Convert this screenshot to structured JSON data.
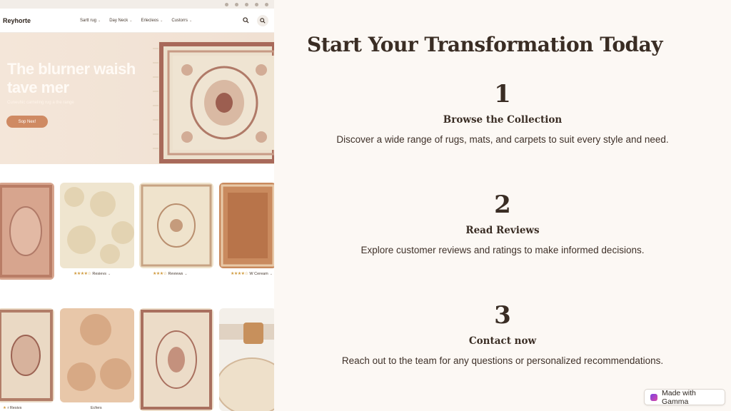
{
  "site": {
    "brand": "Reyhorte",
    "nav": [
      {
        "label": "Sartt rug"
      },
      {
        "label": "Day Neck"
      },
      {
        "label": "Erlecleos"
      },
      {
        "label": "Custorrs"
      }
    ],
    "hero": {
      "title": "The blurner waish tave mer",
      "subtitle": "Cuneuhic carneling rug a the range",
      "button": "Sop Nex!"
    },
    "row1_ratings": [
      {
        "stars": "★★★★☆",
        "label": "Resievs"
      },
      {
        "stars": "★★★☆",
        "label": "Reviews"
      },
      {
        "stars": "★★★★☆",
        "label": "W Ceream"
      }
    ],
    "row2_captions": [
      {
        "label": "r Resivs"
      },
      {
        "label": "Ecfers"
      }
    ]
  },
  "heading": "Start Your Transformation Today",
  "steps": [
    {
      "num": "1",
      "title": "Browse the Collection",
      "desc": "Discover a wide range of rugs, mats, and carpets to suit every style and need."
    },
    {
      "num": "2",
      "title": "Read Reviews",
      "desc": "Explore customer reviews and ratings to make informed decisions."
    },
    {
      "num": "3",
      "title": "Contact now",
      "desc": "Reach out to the team for any questions or personalized recommendations."
    }
  ],
  "badge": {
    "label": "Made with Gamma"
  },
  "colors": {
    "accent_button": "#cf8a63",
    "text_dark": "#3a2d24",
    "background": "#fcf8f4"
  }
}
